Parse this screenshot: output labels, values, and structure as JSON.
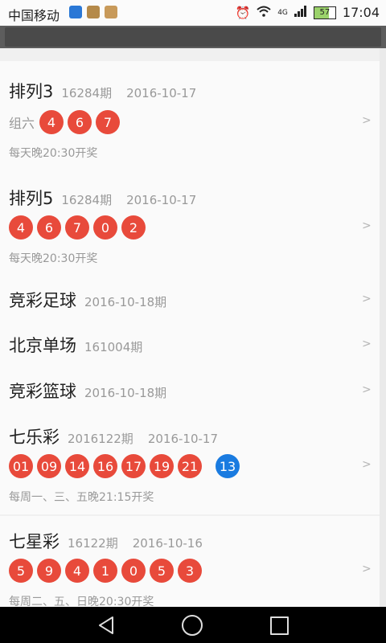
{
  "status_bar": {
    "carrier": "中国移动",
    "network": "4G",
    "battery": "57",
    "time": "17:04"
  },
  "lotteries": [
    {
      "name": "排列3",
      "issue": "16284期",
      "date": "2016-10-17",
      "prefix": "组六",
      "balls": [
        "4",
        "6",
        "7"
      ],
      "blue_balls": [],
      "note": "每天晚20:30开奖"
    },
    {
      "name": "排列5",
      "issue": "16284期",
      "date": "2016-10-17",
      "prefix": "",
      "balls": [
        "4",
        "6",
        "7",
        "0",
        "2"
      ],
      "blue_balls": [],
      "note": "每天晚20:30开奖"
    },
    {
      "name": "竞彩足球",
      "issue": "2016-10-18期",
      "date": "",
      "prefix": "",
      "balls": [],
      "blue_balls": [],
      "note": ""
    },
    {
      "name": "北京单场",
      "issue": "161004期",
      "date": "",
      "prefix": "",
      "balls": [],
      "blue_balls": [],
      "note": ""
    },
    {
      "name": "竞彩篮球",
      "issue": "2016-10-18期",
      "date": "",
      "prefix": "",
      "balls": [],
      "blue_balls": [],
      "note": ""
    },
    {
      "name": "七乐彩",
      "issue": "2016122期",
      "date": "2016-10-17",
      "prefix": "",
      "balls": [
        "01",
        "09",
        "14",
        "16",
        "17",
        "19",
        "21"
      ],
      "blue_balls": [
        "13"
      ],
      "note": "每周一、三、五晚21:15开奖"
    },
    {
      "name": "七星彩",
      "issue": "16122期",
      "date": "2016-10-16",
      "prefix": "",
      "balls": [
        "5",
        "9",
        "4",
        "1",
        "0",
        "5",
        "3"
      ],
      "blue_balls": [],
      "note": "每周二、五、日晚20:30开奖"
    }
  ],
  "colors": {
    "red_ball": "#e84a3b",
    "blue_ball": "#1a7be0"
  },
  "icons": {
    "row_arrow": "chevron-right-icon"
  }
}
